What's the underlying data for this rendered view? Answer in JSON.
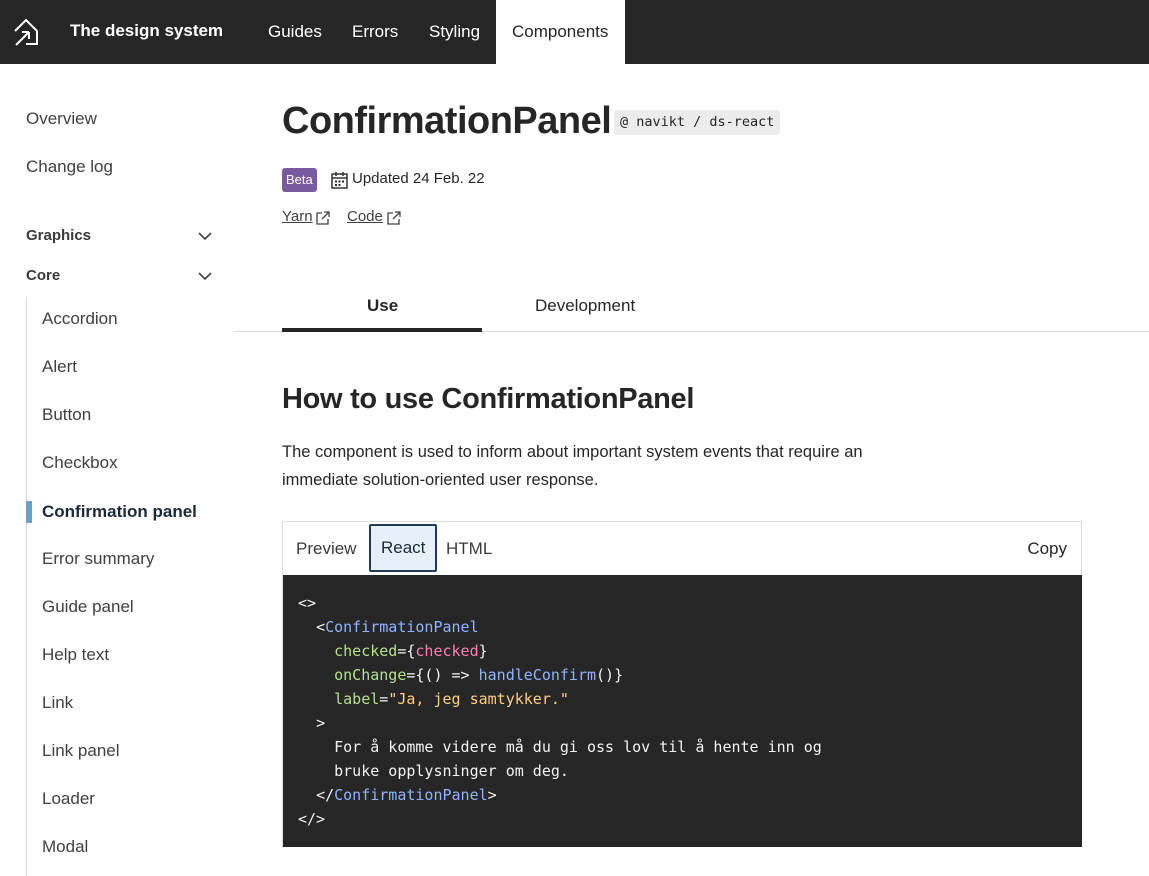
{
  "header": {
    "brand": "The design system",
    "nav": [
      "Guides",
      "Errors",
      "Styling",
      "Components"
    ],
    "active_nav": "Components"
  },
  "sidebar": {
    "top_links": [
      "Overview",
      "Change log"
    ],
    "groups": [
      "Graphics",
      "Core"
    ],
    "core_items": [
      "Accordion",
      "Alert",
      "Button",
      "Checkbox",
      "Confirmation panel",
      "Error summary",
      "Guide panel",
      "Help text",
      "Link",
      "Link panel",
      "Loader",
      "Modal"
    ],
    "active_item": "Confirmation panel"
  },
  "page": {
    "title": "ConfirmationPanel",
    "package": "@ navikt / ds-react",
    "badge": "Beta",
    "updated": "Updated 24 Feb. 22",
    "links": [
      "Yarn",
      "Code"
    ],
    "tabs": [
      "Use",
      "Development"
    ],
    "active_tab": "Use",
    "heading": "How to use ConfirmationPanel",
    "description": "The component is used to inform about important system events that require an immediate solution-oriented user response."
  },
  "example": {
    "tabs": [
      "Preview",
      "React",
      "HTML"
    ],
    "active_tab": "React",
    "copy_label": "Copy",
    "code": {
      "l1": "<>",
      "open_lt": "<",
      "component": "ConfirmationPanel",
      "attr_checked": "checked",
      "eq_open": "={",
      "var_checked": "checked",
      "close_brace": "}",
      "attr_onchange": "onChange",
      "arrow": "={() => ",
      "fn": "handleConfirm",
      "call_close": "()}",
      "attr_label": "label",
      "eq_str": "=",
      "label_str": "\"Ja, jeg samtykker.\"",
      "gt": ">",
      "text1": "For å komme videre må du gi oss lov til å hente inn og",
      "text2": "bruke opplysninger om deg.",
      "close_lt": "</",
      "close_gt": ">",
      "frag_close": "</>"
    }
  },
  "colors": {
    "header_bg": "#262626",
    "beta_badge": "#7a5a9e",
    "active_marker": "#66a3c4",
    "code_bg": "#262626",
    "react_tab_bg": "#e6effa",
    "react_tab_border": "#1f3a5f"
  }
}
